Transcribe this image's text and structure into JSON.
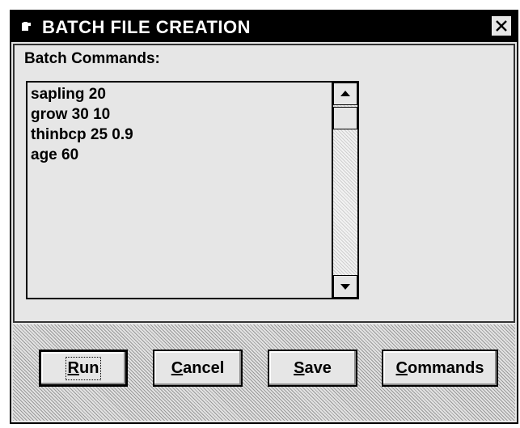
{
  "window": {
    "title": "BATCH FILE CREATION"
  },
  "panel": {
    "label": "Batch Commands:"
  },
  "listbox": {
    "lines": [
      "sapling 20",
      "grow 30 10",
      "thinbcp 25 0.9",
      "age 60"
    ]
  },
  "buttons": {
    "run": {
      "label": "Run",
      "mnemonic": "R",
      "rest": "un"
    },
    "cancel": {
      "label": "Cancel",
      "mnemonic": "C",
      "rest": "ancel"
    },
    "save": {
      "label": "Save",
      "mnemonic": "S",
      "rest": "ave"
    },
    "commands": {
      "label": "Commands",
      "mnemonic": "C",
      "rest": "ommands"
    }
  },
  "icons": {
    "title": "window-menu-icon",
    "close": "close-icon",
    "scroll_up": "scroll-up-arrow-icon",
    "scroll_down": "scroll-down-arrow-icon"
  }
}
